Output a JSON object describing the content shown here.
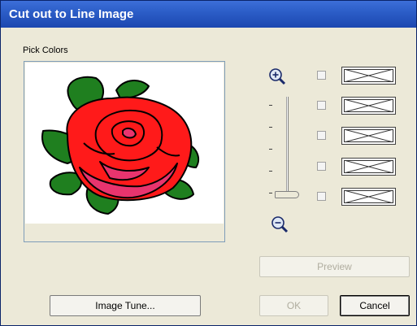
{
  "window": {
    "title": "Cut out to Line Image"
  },
  "group": {
    "label": "Pick Colors"
  },
  "icons": {
    "zoom_in": "zoom-in-icon",
    "zoom_out": "zoom-out-icon",
    "swatch": "empty-swatch-x-icon"
  },
  "colors": {
    "titlebar": "#2c5ec8",
    "rose_red": "#ff1a1a",
    "rose_pink": "#e8346e",
    "leaf_green": "#1f7f1f"
  },
  "color_slots": [
    {
      "checked": false
    },
    {
      "checked": false
    },
    {
      "checked": false
    },
    {
      "checked": false
    },
    {
      "checked": false
    }
  ],
  "buttons": {
    "preview": "Preview",
    "image_tune": "Image Tune...",
    "ok": "OK",
    "cancel": "Cancel"
  }
}
